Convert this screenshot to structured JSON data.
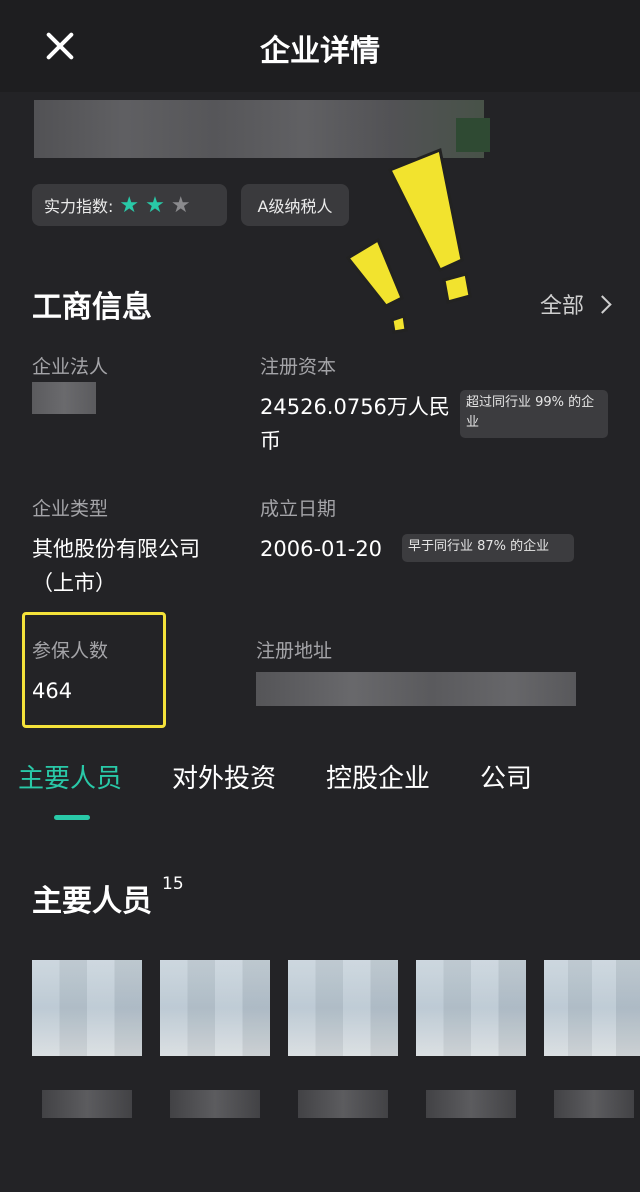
{
  "header": {
    "title": "企业详情"
  },
  "company": {
    "strength_label": "实力指数:",
    "strength_stars": 2,
    "strength_max": 3,
    "tax_badge": "A级纳税人"
  },
  "business": {
    "section_title": "工商信息",
    "all_link": "全部",
    "legal_rep_label": "企业法人",
    "capital_label": "注册资本",
    "capital_value": "24526.0756万人民币",
    "capital_note": "超过同行业 99% 的企业",
    "type_label": "企业类型",
    "type_value": "其他股份有限公司（上市）",
    "founded_label": "成立日期",
    "founded_value": "2006-01-20",
    "founded_note": "早于同行业 87% 的企业",
    "insured_label": "参保人数",
    "insured_value": "464",
    "address_label": "注册地址"
  },
  "tabs": [
    {
      "label": "主要人员",
      "active": true
    },
    {
      "label": "对外投资",
      "active": false
    },
    {
      "label": "控股企业",
      "active": false
    },
    {
      "label": "公司",
      "active": false
    }
  ],
  "people": {
    "title": "主要人员",
    "count": "15"
  },
  "colors": {
    "accent": "#29c9a8",
    "highlight": "#f4e23a",
    "background": "#232326"
  }
}
